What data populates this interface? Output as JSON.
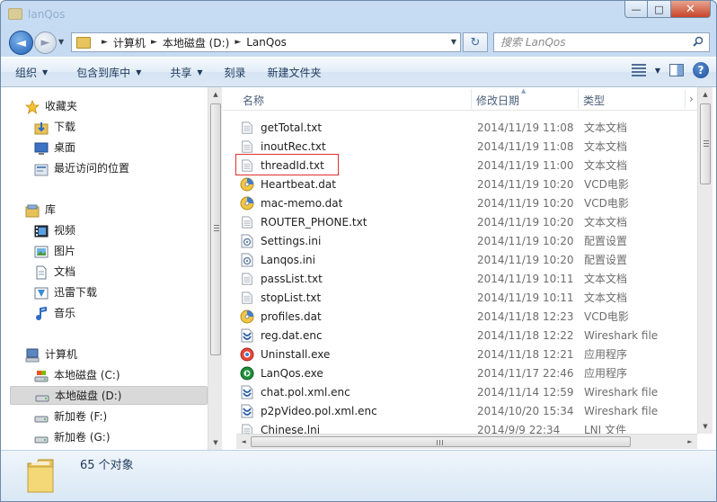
{
  "window": {
    "title": "lanQos",
    "btn_min": "—",
    "btn_max": "□",
    "btn_close": "✕"
  },
  "nav": {
    "back": "◄",
    "forward": "►",
    "history_drop": "▼",
    "breadcrumb": [
      "计算机",
      "本地磁盘 (D:)",
      "LanQos"
    ],
    "refresh": "↻",
    "search_placeholder": "搜索 LanQos"
  },
  "toolbar": {
    "items": [
      "组织",
      "包含到库中",
      "共享",
      "刻录",
      "新建文件夹"
    ],
    "has_dropdown": [
      true,
      true,
      true,
      false,
      false
    ],
    "view_drop": "▼",
    "help": "?"
  },
  "sidebar": {
    "favorites_label": "收藏夹",
    "favorites": [
      "下载",
      "桌面",
      "最近访问的位置"
    ],
    "libraries_label": "库",
    "libraries": [
      "视频",
      "图片",
      "文档",
      "迅雷下载",
      "音乐"
    ],
    "computer_label": "计算机",
    "drives": [
      "本地磁盘 (C:)",
      "本地磁盘 (D:)",
      "新加卷 (F:)",
      "新加卷 (G:)"
    ],
    "selected": "本地磁盘 (D:)"
  },
  "columns": {
    "name": "名称",
    "date": "修改日期",
    "type": "类型"
  },
  "files": [
    {
      "name": "getTotal.txt",
      "date": "2014/11/19 11:08",
      "type": "文本文档",
      "icon": "txt"
    },
    {
      "name": "inoutRec.txt",
      "date": "2014/11/19 11:08",
      "type": "文本文档",
      "icon": "txt"
    },
    {
      "name": "threadId.txt",
      "date": "2014/11/19 11:00",
      "type": "文本文档",
      "icon": "txt"
    },
    {
      "name": "Heartbeat.dat",
      "date": "2014/11/19 10:20",
      "type": "VCD电影",
      "icon": "vcd"
    },
    {
      "name": "mac-memo.dat",
      "date": "2014/11/19 10:20",
      "type": "VCD电影",
      "icon": "vcd"
    },
    {
      "name": "ROUTER_PHONE.txt",
      "date": "2014/11/19 10:20",
      "type": "文本文档",
      "icon": "txt"
    },
    {
      "name": "Settings.ini",
      "date": "2014/11/19 10:20",
      "type": "配置设置",
      "icon": "ini"
    },
    {
      "name": "Lanqos.ini",
      "date": "2014/11/19 10:20",
      "type": "配置设置",
      "icon": "ini"
    },
    {
      "name": "passList.txt",
      "date": "2014/11/19 10:11",
      "type": "文本文档",
      "icon": "txt"
    },
    {
      "name": "stopList.txt",
      "date": "2014/11/19 10:11",
      "type": "文本文档",
      "icon": "txt"
    },
    {
      "name": "profiles.dat",
      "date": "2014/11/18 12:23",
      "type": "VCD电影",
      "icon": "vcd"
    },
    {
      "name": "reg.dat.enc",
      "date": "2014/11/18 12:22",
      "type": "Wireshark file",
      "icon": "enc"
    },
    {
      "name": "Uninstall.exe",
      "date": "2014/11/18 12:21",
      "type": "应用程序",
      "icon": "uninstall"
    },
    {
      "name": "LanQos.exe",
      "date": "2014/11/17 22:46",
      "type": "应用程序",
      "icon": "exe"
    },
    {
      "name": "chat.pol.xml.enc",
      "date": "2014/11/14 12:59",
      "type": "Wireshark file",
      "icon": "enc"
    },
    {
      "name": "p2pVideo.pol.xml.enc",
      "date": "2014/10/20 15:34",
      "type": "Wireshark file",
      "icon": "enc"
    },
    {
      "name": "Chinese.lni",
      "date": "2014/9/9 22:34",
      "type": "LNI 文件",
      "icon": "txt"
    }
  ],
  "details": {
    "count": "65 个对象"
  }
}
